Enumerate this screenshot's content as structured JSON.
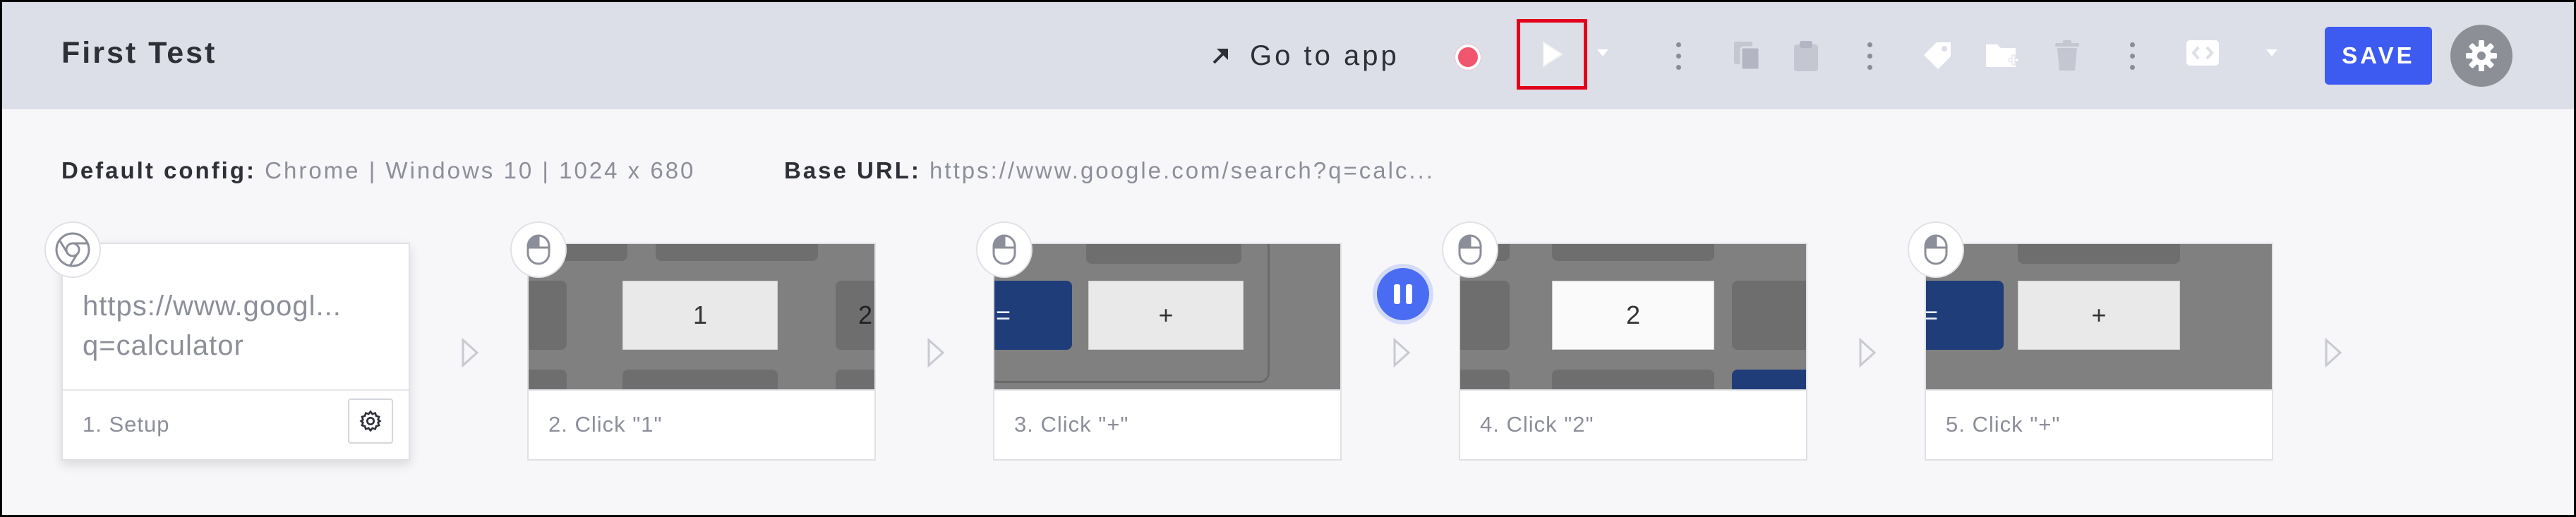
{
  "header": {
    "title": "First Test",
    "goto_label": "Go to app",
    "save_label": "SAVE"
  },
  "config": {
    "default_label": "Default config:",
    "default_value": "Chrome | Windows 10 | 1024 x 680",
    "base_url_label": "Base URL:",
    "base_url_value": "https://www.google.com/search?q=calc..."
  },
  "steps": [
    {
      "label": "1. Setup",
      "url_line1": "https://www.googl...",
      "url_line2": "q=calculator"
    },
    {
      "label": "2. Click \"1\"",
      "key": "1",
      "edge_key": "2"
    },
    {
      "label": "3. Click \"+\"",
      "key": "+",
      "edge_key": "="
    },
    {
      "label": "4. Click \"2\"",
      "key": "2"
    },
    {
      "label": "5. Click \"+\"",
      "key": "+",
      "edge_key": "="
    }
  ],
  "colors": {
    "accent": "#3d5af1",
    "record": "#f0566e",
    "highlight": "#e2001a"
  }
}
